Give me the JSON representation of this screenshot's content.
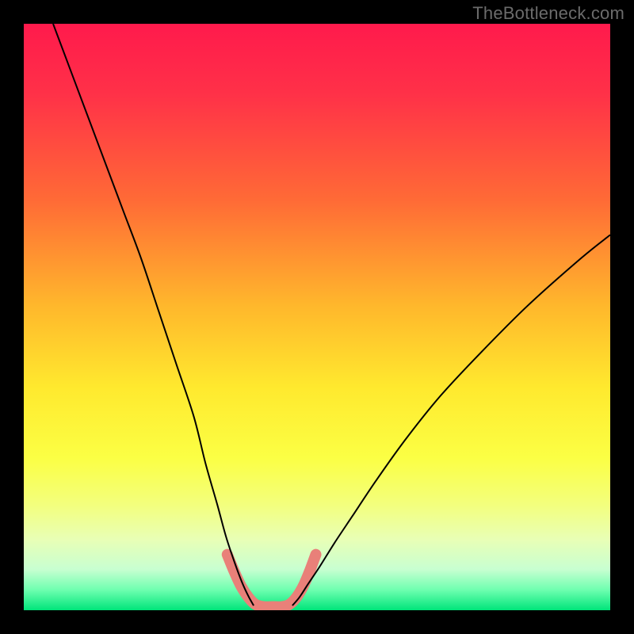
{
  "watermark": "TheBottleneck.com",
  "chart_data": {
    "type": "line",
    "title": "",
    "xlabel": "",
    "ylabel": "",
    "xlim": [
      0,
      100
    ],
    "ylim": [
      0,
      100
    ],
    "grid": false,
    "legend": false,
    "background_gradient": {
      "stops": [
        {
          "offset": 0.0,
          "color": "#ff1a4c"
        },
        {
          "offset": 0.12,
          "color": "#ff3148"
        },
        {
          "offset": 0.3,
          "color": "#ff6a36"
        },
        {
          "offset": 0.48,
          "color": "#ffb72c"
        },
        {
          "offset": 0.62,
          "color": "#ffe92e"
        },
        {
          "offset": 0.74,
          "color": "#fbff44"
        },
        {
          "offset": 0.82,
          "color": "#f3ff7d"
        },
        {
          "offset": 0.88,
          "color": "#e8ffb6"
        },
        {
          "offset": 0.93,
          "color": "#c8ffd1"
        },
        {
          "offset": 0.965,
          "color": "#6fffb0"
        },
        {
          "offset": 1.0,
          "color": "#00e57a"
        }
      ]
    },
    "series": [
      {
        "name": "left-curve",
        "type": "line",
        "color": "#000000",
        "stroke_width": 2,
        "x": [
          5,
          8,
          11,
          14,
          17,
          20,
          23,
          26,
          29,
          31,
          33,
          34.5,
          36,
          37.2,
          38.3,
          39.2
        ],
        "y": [
          100,
          92,
          84,
          76,
          68,
          60,
          51,
          42,
          33,
          25,
          18,
          12.5,
          8,
          4.8,
          2.4,
          0.8
        ]
      },
      {
        "name": "right-curve",
        "type": "line",
        "color": "#000000",
        "stroke_width": 2,
        "x": [
          45.8,
          47,
          48.5,
          50.5,
          53,
          56,
          60,
          65,
          71,
          78,
          86,
          95,
          100
        ],
        "y": [
          0.8,
          2.2,
          4.5,
          7.5,
          11.5,
          16,
          22,
          29,
          36.5,
          44,
          52,
          60,
          64
        ]
      },
      {
        "name": "trough-band",
        "type": "line",
        "color": "#e98079",
        "stroke_width": 14,
        "linecap": "round",
        "x": [
          34.7,
          35.8,
          37.0,
          38.3,
          39.5,
          41.0,
          42.5,
          44.0,
          45.3,
          46.5,
          47.7,
          48.8,
          49.8
        ],
        "y": [
          9.5,
          6.8,
          4.2,
          2.2,
          1.0,
          0.6,
          0.6,
          0.6,
          1.0,
          2.2,
          4.2,
          6.8,
          9.5
        ]
      }
    ]
  }
}
